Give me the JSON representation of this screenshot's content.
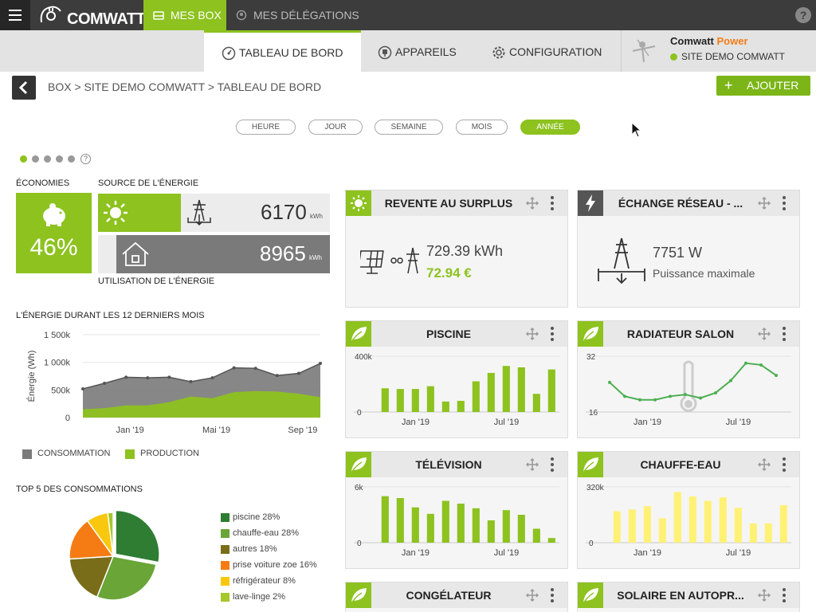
{
  "topbar": {
    "logo_text": "COMWATT",
    "tabs": [
      {
        "label": "MES BOX",
        "icon": "box-icon"
      },
      {
        "label": "MES DÉLÉGATIONS",
        "icon": "delegations-icon"
      }
    ],
    "help_label": "?"
  },
  "subnav": {
    "tabs": [
      {
        "label": "TABLEAU DE BORD",
        "icon": "gauge-icon"
      },
      {
        "label": "APPAREILS",
        "icon": "plug-icon"
      },
      {
        "label": "CONFIGURATION",
        "icon": "gear-icon"
      }
    ],
    "site": {
      "brand": "Comwatt",
      "brand_accent": "Power",
      "name": "SITE DEMO COMWATT",
      "status_color": "#8dc21f"
    }
  },
  "breadcrumb": {
    "text": "BOX > SITE DEMO COMWATT > TABLEAU DE BORD"
  },
  "add_button": {
    "plus": "+",
    "label": "AJOUTER"
  },
  "periods": [
    "HEURE",
    "JOUR",
    "SEMAINE",
    "MOIS",
    "ANNÉE"
  ],
  "active_period": "ANNÉE",
  "help_circle": "?",
  "summary": {
    "economies_title": "ÉCONOMIES",
    "economies_value": "46%",
    "source_title": "SOURCE DE L'ÉNERGIE",
    "source_value": "6170",
    "source_unit": "kWh",
    "usage_value": "8965",
    "usage_unit": "kWh",
    "usage_title": "UTILISATION DE L'ÉNERGIE"
  },
  "energy_chart": {
    "title": "L'ÉNERGIE DURANT LES 12 DERNIERS MOIS",
    "legend": [
      {
        "label": "CONSOMMATION",
        "color": "#7a7a7a"
      },
      {
        "label": "PRODUCTION",
        "color": "#8dc21f"
      }
    ]
  },
  "top5": {
    "title": "TOP 5 DES CONSOMMATIONS",
    "items": [
      {
        "label": "piscine 28%",
        "value": 28,
        "color": "#2e7d32"
      },
      {
        "label": "chauffe-eau 28%",
        "value": 28,
        "color": "#6aa538"
      },
      {
        "label": "autres 18%",
        "value": 18,
        "color": "#7a6d1a"
      },
      {
        "label": "prise voiture zoe 16%",
        "value": 16,
        "color": "#f57c14"
      },
      {
        "label": "réfrigérateur 8%",
        "value": 8,
        "color": "#f9c80e"
      },
      {
        "label": "lave-linge 2%",
        "value": 2,
        "color": "#a5c82a"
      }
    ]
  },
  "widgets": {
    "revente": {
      "title": "REVENTE AU SURPLUS",
      "energy": "729.39 kWh",
      "money": "72.94 €",
      "icon": "sun-icon"
    },
    "echange": {
      "title": "ÉCHANGE RÉSEAU - ...",
      "value": "7751 W",
      "caption": "Puissance maximale",
      "icon": "lightning-icon"
    },
    "piscine": {
      "title": "PISCINE",
      "icon": "leaf-icon"
    },
    "radiateur": {
      "title": "RADIATEUR SALON",
      "icon": "leaf-icon"
    },
    "television": {
      "title": "TÉLÉVISION",
      "icon": "leaf-icon"
    },
    "chauffe": {
      "title": "CHAUFFE-EAU",
      "icon": "leaf-icon"
    },
    "congelateur": {
      "title": "CONGÉLATEUR",
      "icon": "leaf-icon"
    },
    "solaire": {
      "title": "SOLAIRE EN AUTOPR...",
      "icon": "leaf-icon"
    }
  },
  "chart_data": [
    {
      "type": "area",
      "title": "L'ÉNERGIE DURANT LES 12 DERNIERS MOIS",
      "ylabel": "Énergie (Wh)",
      "y_ticks": [
        "1 500k",
        "1 000k",
        "500k",
        "0"
      ],
      "x_ticks": [
        "Jan '19",
        "Mai '19",
        "Sep '19"
      ],
      "ylim": [
        0,
        1500000
      ],
      "series": [
        {
          "name": "CONSOMMATION",
          "color": "#7a7a7a",
          "values": [
            520000,
            620000,
            730000,
            720000,
            730000,
            650000,
            720000,
            900000,
            890000,
            760000,
            800000,
            980000
          ]
        },
        {
          "name": "PRODUCTION",
          "color": "#8dc21f",
          "values": [
            150000,
            170000,
            220000,
            220000,
            280000,
            380000,
            350000,
            460000,
            480000,
            470000,
            430000,
            370000
          ]
        }
      ]
    },
    {
      "type": "pie",
      "title": "TOP 5 DES CONSOMMATIONS",
      "categories": [
        "piscine",
        "chauffe-eau",
        "autres",
        "prise voiture zoe",
        "réfrigérateur",
        "lave-linge"
      ],
      "values": [
        28,
        28,
        18,
        16,
        8,
        2
      ]
    },
    {
      "type": "bar",
      "title": "PISCINE",
      "y_ticks": [
        "400k",
        "0"
      ],
      "x_ticks": [
        "Jan '19",
        "Jul '19"
      ],
      "ylim": [
        0,
        400000
      ],
      "values": [
        170000,
        165000,
        165000,
        185000,
        75000,
        80000,
        220000,
        280000,
        330000,
        320000,
        130000,
        305000
      ],
      "color": "#8dc21f"
    },
    {
      "type": "line",
      "title": "RADIATEUR SALON",
      "y_ticks": [
        "32",
        "16"
      ],
      "x_ticks": [
        "Jan '19",
        "Jul '19"
      ],
      "ylim": [
        16,
        32
      ],
      "values": [
        24.5,
        20.5,
        19.5,
        19.5,
        20.5,
        21,
        20,
        21.5,
        25,
        30,
        29.5,
        26.5
      ],
      "color": "#4caf50"
    },
    {
      "type": "bar",
      "title": "TÉLÉVISION",
      "y_ticks": [
        "6k",
        "0"
      ],
      "x_ticks": [
        "Jan '19",
        "Jul '19"
      ],
      "ylim": [
        0,
        6000
      ],
      "values": [
        5000,
        4800,
        3800,
        3100,
        4500,
        4200,
        3700,
        2400,
        3500,
        3000,
        1500,
        500
      ],
      "color": "#8dc21f"
    },
    {
      "type": "bar",
      "title": "CHAUFFE-EAU",
      "y_ticks": [
        "320k",
        "0"
      ],
      "x_ticks": [
        "Jan '19",
        "Jul '19"
      ],
      "ylim": [
        0,
        320000
      ],
      "values": [
        180000,
        190000,
        210000,
        140000,
        290000,
        265000,
        240000,
        260000,
        200000,
        110000,
        110000,
        215000
      ],
      "color": "#fff176"
    }
  ]
}
